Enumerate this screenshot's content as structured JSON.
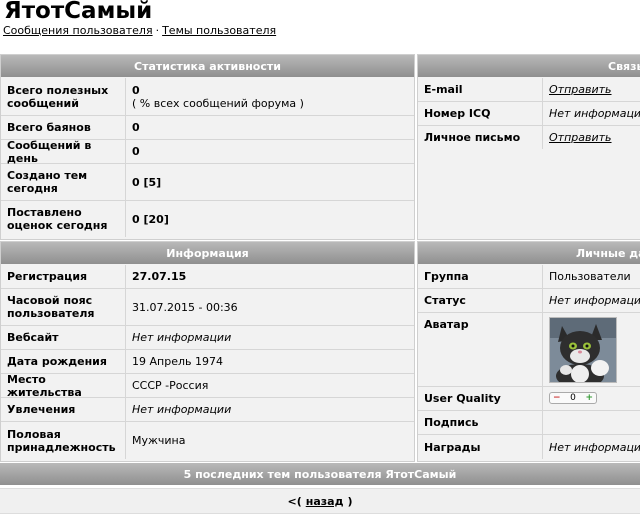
{
  "profile": {
    "username": "ЯтотСамый",
    "link_posts": "Сообщения пользователя",
    "link_sep": "·",
    "link_topics": "Темы пользователя"
  },
  "activity": {
    "header": "Статистика активности",
    "rows": [
      {
        "label": "Всего полезных сообщений",
        "value": "0",
        "sub": "( % всех сообщений форума )"
      },
      {
        "label": "Всего баянов",
        "value": "0"
      },
      {
        "label": "Сообщений в день",
        "value": "0"
      },
      {
        "label": "Создано тем сегодня",
        "value": "0 [5]"
      },
      {
        "label": "Поставлено оценок сегодня",
        "value": "0 [20]"
      }
    ]
  },
  "contacts": {
    "header": "Связь",
    "rows": [
      {
        "label": "E-mail",
        "value": "Отправить"
      },
      {
        "label": "Номер ICQ",
        "value": "Нет информации"
      },
      {
        "label": "Личное письмо",
        "value": "Отправить"
      }
    ]
  },
  "info": {
    "header": "Информация",
    "rows": [
      {
        "label": "Регистрация",
        "value": "27.07.15"
      },
      {
        "label": "Часовой пояс пользователя",
        "value": "31.07.2015 - 00:36"
      },
      {
        "label": "Вебсайт",
        "value": "Нет информации"
      },
      {
        "label": "Дата рождения",
        "value": "19 Апрель 1974"
      },
      {
        "label": "Место жительства",
        "value": "СССР -Россия"
      },
      {
        "label": "Увлечения",
        "value": "Нет информации"
      },
      {
        "label": "Половая принадлежность",
        "value": "Мужчина"
      }
    ]
  },
  "personal": {
    "header": "Личные данные",
    "rows": [
      {
        "label": "Группа",
        "value": "Пользователи"
      },
      {
        "label": "Статус",
        "value": "Нет информации"
      },
      {
        "label": "Аватар",
        "value": ""
      },
      {
        "label": "User Quality",
        "value": "0",
        "minus": "−",
        "plus": "+"
      },
      {
        "label": "Подпись",
        "value": ""
      },
      {
        "label": "Награды",
        "value": "Нет информации"
      }
    ]
  },
  "last_topics": {
    "header": "5 последних тем пользователя ЯтотСамый"
  },
  "nav": {
    "prefix": "<(",
    "back": "назад",
    "suffix": ")"
  },
  "colors": {
    "header_bg": "#a5a5a5",
    "panel_bg": "#f2f2f2"
  }
}
